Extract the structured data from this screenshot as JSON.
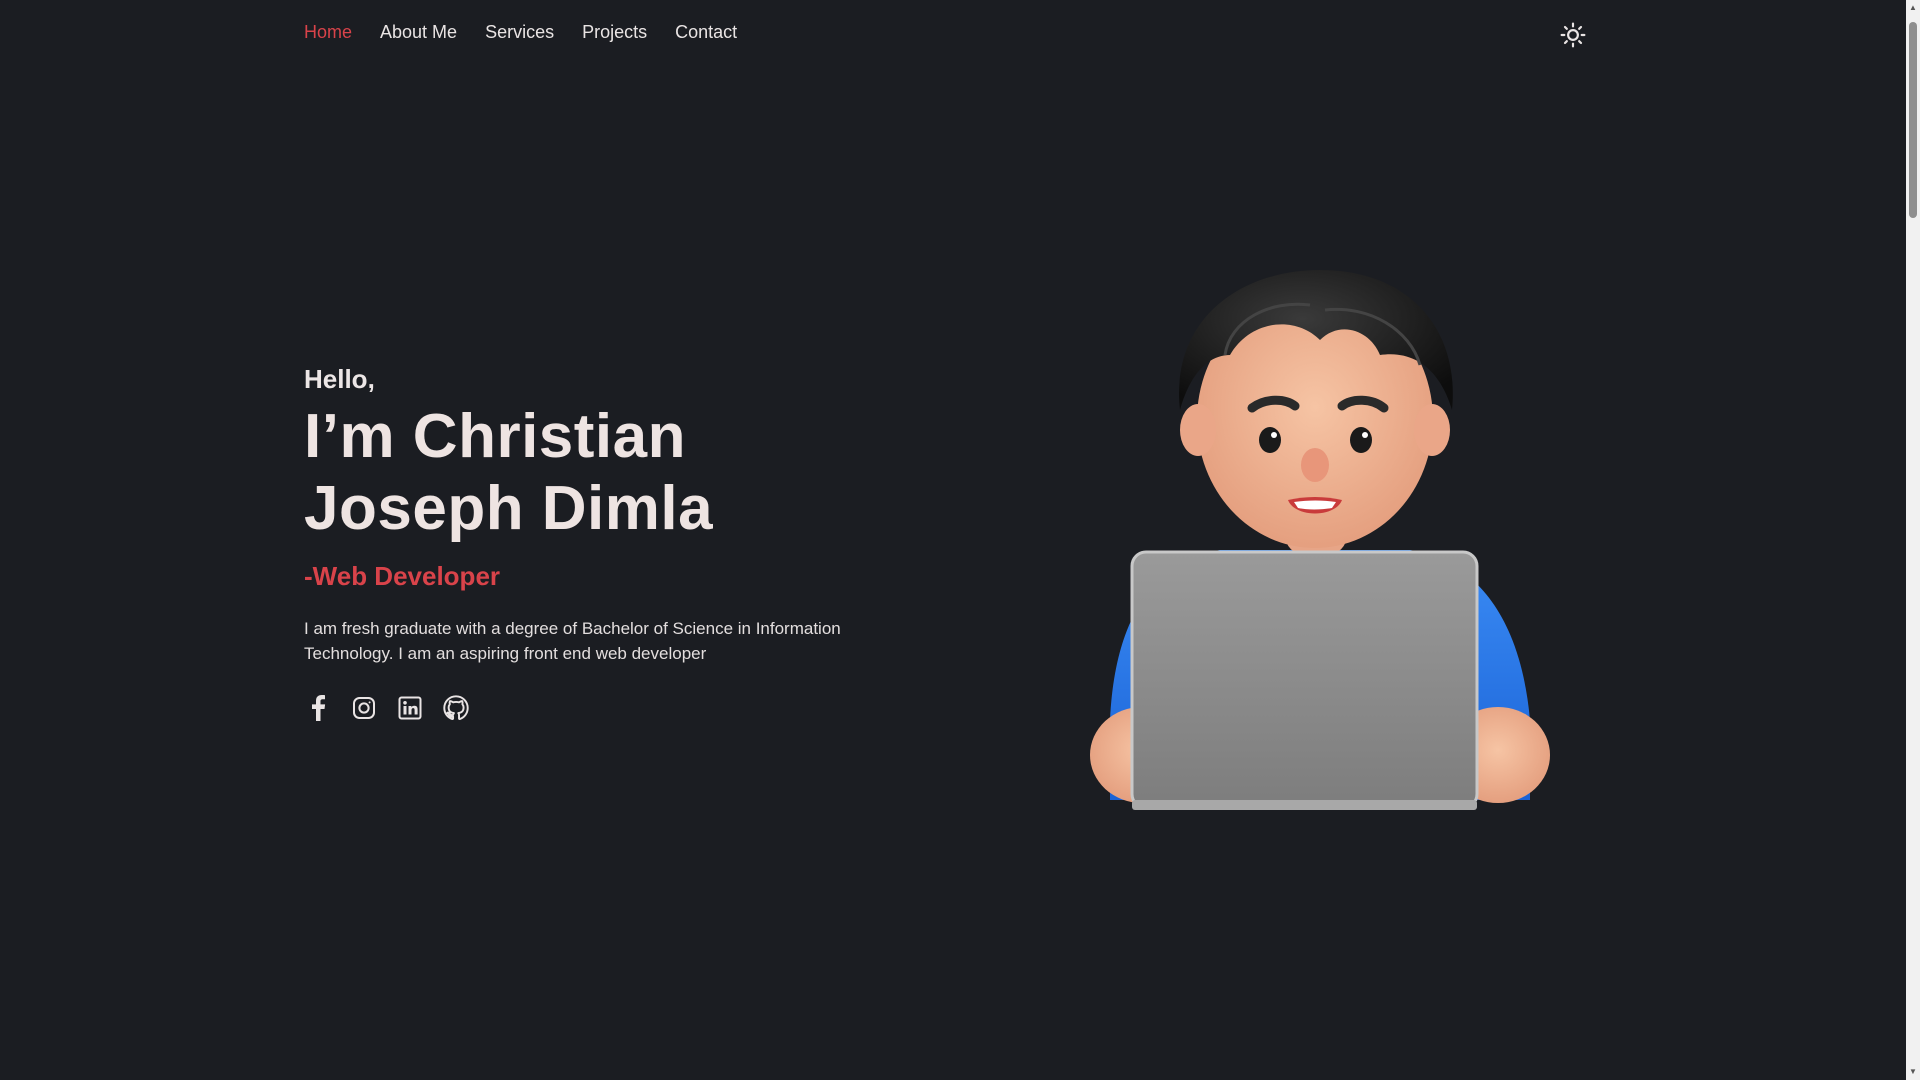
{
  "nav": {
    "items": [
      {
        "label": "Home",
        "active": true
      },
      {
        "label": "About Me",
        "active": false
      },
      {
        "label": "Services",
        "active": false
      },
      {
        "label": "Projects",
        "active": false
      },
      {
        "label": "Contact",
        "active": false
      }
    ],
    "theme_toggle_icon": "sun-icon"
  },
  "hero": {
    "greeting": "Hello,",
    "name_line1": "I’m Christian",
    "name_line2": "Joseph Dimla",
    "role": "-Web Developer",
    "description_line1": "I am fresh graduate with a degree of Bachelor of Science in Information",
    "description_line2": "Technology. I am an aspiring front end web developer"
  },
  "socials": [
    {
      "icon": "facebook-icon"
    },
    {
      "icon": "instagram-icon"
    },
    {
      "icon": "linkedin-icon"
    },
    {
      "icon": "github-icon"
    }
  ],
  "colors": {
    "background": "#1b1d22",
    "accent": "#d9434a",
    "text": "#e9e4e4"
  }
}
